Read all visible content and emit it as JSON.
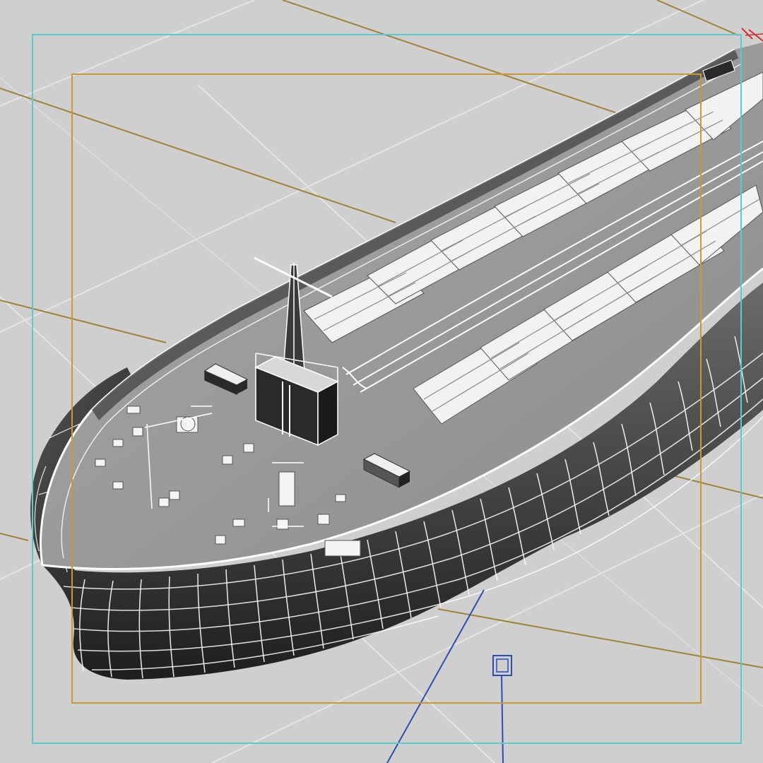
{
  "viewport": {
    "label": "",
    "background": "#cfcfcf",
    "colors": {
      "safe_frame_outer": "#5ec9cc",
      "safe_frame_inner": "#c49a3a",
      "camera_lines": "#a08338",
      "target_line": "#2a4fb0",
      "grid": "#e6e6e6",
      "wireframe": "#ffffff",
      "hull_shade": "#3a3a3a",
      "deck": "#9c9c9c"
    },
    "objects": [
      "bulk-carrier-ship-wireframe",
      "camera-target-icon",
      "safe-frame-outer",
      "safe-frame-inner"
    ]
  }
}
